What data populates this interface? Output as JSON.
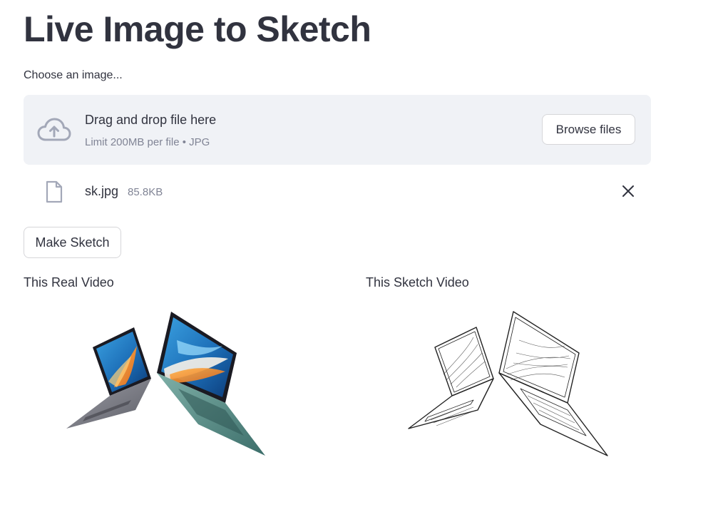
{
  "page": {
    "title": "Live Image to Sketch"
  },
  "uploader": {
    "label": "Choose an image...",
    "drop_title": "Drag and drop file here",
    "drop_subtitle": "Limit 200MB per file • JPG",
    "browse_label": "Browse files"
  },
  "uploaded_file": {
    "name": "sk.jpg",
    "size": "85.8KB"
  },
  "actions": {
    "make_sketch_label": "Make Sketch"
  },
  "columns": {
    "left_label": "This Real Video",
    "right_label": "This Sketch Video"
  },
  "colors": {
    "text": "#31333f",
    "muted": "#808495",
    "dropzone_bg": "#f0f2f6",
    "icon": "#a3a8b8"
  },
  "icons": {
    "upload": "cloud-upload-icon",
    "file": "file-icon",
    "close": "close-icon"
  }
}
